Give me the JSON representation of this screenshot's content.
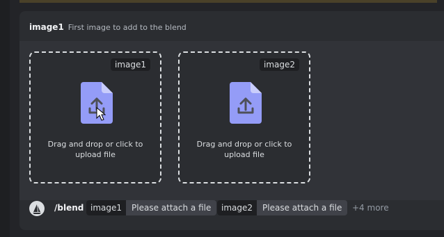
{
  "option": {
    "name": "image1",
    "description": "First image to add to the blend"
  },
  "dropzones": [
    {
      "tag": "image1",
      "text": "Drag and drop or click to\nupload file"
    },
    {
      "tag": "image2",
      "text": "Drag and drop or click to\nupload file"
    }
  ],
  "command": {
    "name": "/blend",
    "options": [
      {
        "key": "image1",
        "value": "Please attach a file"
      },
      {
        "key": "image2",
        "value": "Please attach a file"
      }
    ],
    "more": "+4 more"
  },
  "icons": {
    "upload": "file-upload-icon",
    "app": "bot-avatar-icon",
    "cursor": "mouse-pointer-icon"
  },
  "colors": {
    "accent": "#949cf7",
    "panel": "#2b2d31",
    "dashed": "#dbdee1"
  }
}
